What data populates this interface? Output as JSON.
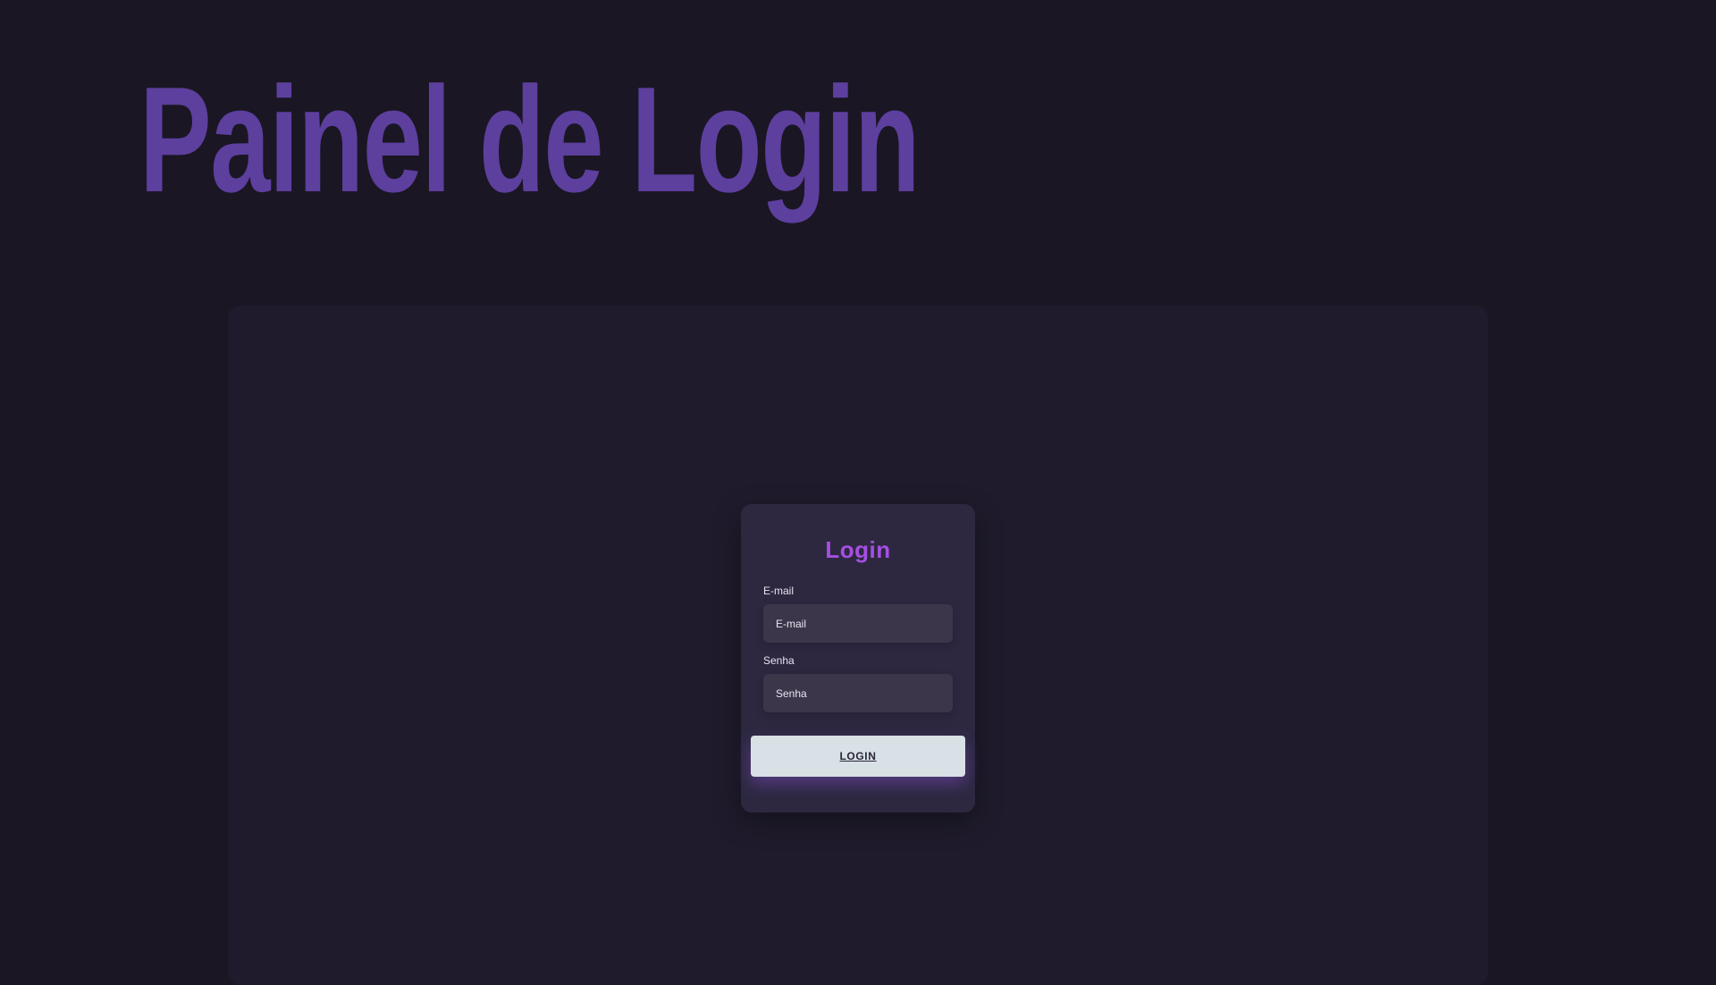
{
  "header": {
    "title": "Painel de Login"
  },
  "login": {
    "heading": "Login",
    "email": {
      "label": "E-mail",
      "placeholder": "E-mail"
    },
    "password": {
      "label": "Senha",
      "placeholder": "Senha"
    },
    "button_label": "LOGIN"
  },
  "colors": {
    "background": "#1a1623",
    "panel": "#1f1b2c",
    "card": "#2d2840",
    "title": "#5d3f9e",
    "heading": "#a64fe3",
    "input": "#3b364a",
    "button": "#d8e1e6"
  }
}
